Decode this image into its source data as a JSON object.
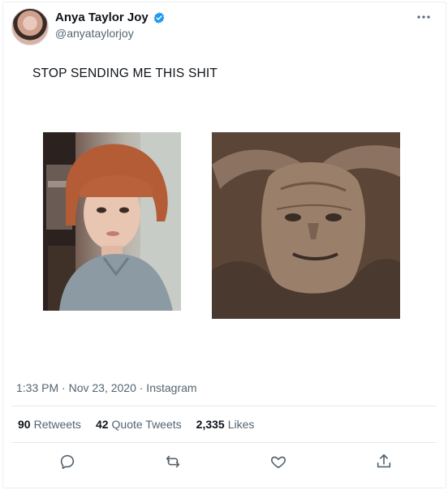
{
  "tweet": {
    "author_name": "Anya Taylor Joy",
    "author_handle": "@anyataylorjoy",
    "text": "STOP SENDING ME THIS SHIT",
    "timestamp": "1:33 PM · Nov 23, 2020 · Instagram",
    "stats": {
      "retweets_count": "90",
      "retweets_label": "Retweets",
      "quote_count": "42",
      "quote_label": "Quote Tweets",
      "likes_count": "2,335",
      "likes_label": "Likes"
    },
    "accent_color": "#1d9bf0",
    "icons": [
      "verified-icon",
      "more-icon",
      "reply-icon",
      "retweet-icon",
      "like-icon",
      "share-icon"
    ]
  }
}
